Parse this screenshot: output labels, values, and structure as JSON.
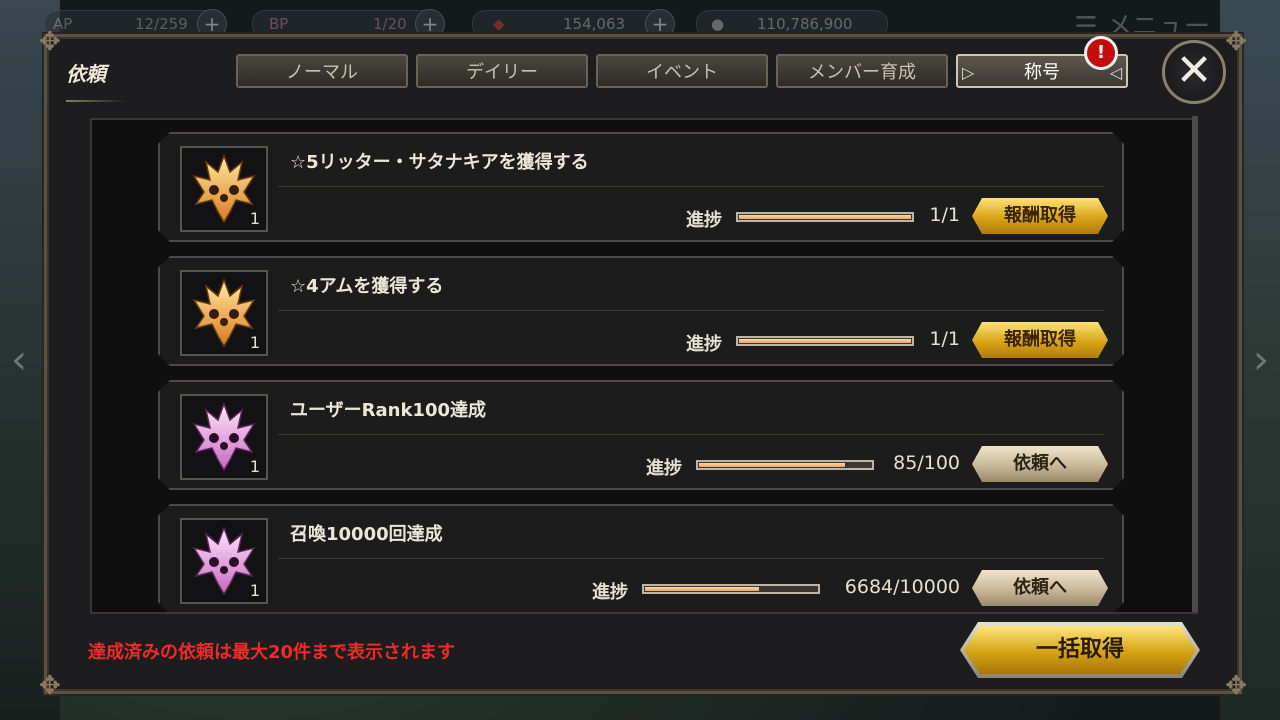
{
  "topbar": {
    "resources": [
      {
        "label": "AP",
        "value": "12/259",
        "icon": "ap-icon"
      },
      {
        "label": "BP",
        "value": "1/20",
        "icon": "bp-icon"
      },
      {
        "label": "",
        "value": "154,063",
        "icon": "gem-icon"
      },
      {
        "label": "",
        "value": "110,786,900",
        "icon": "coin-icon"
      }
    ],
    "menu_label": "メニュー"
  },
  "panel": {
    "title": "依頼",
    "close_icon": "close-icon",
    "alert_icon": "!"
  },
  "tabs": [
    {
      "label": "ノーマル",
      "active": false
    },
    {
      "label": "デイリー",
      "active": false
    },
    {
      "label": "イベント",
      "active": false
    },
    {
      "label": "メンバー育成",
      "active": false
    },
    {
      "label": "称号",
      "active": true
    }
  ],
  "quests": [
    {
      "title": "☆5リッター・サタナキアを獲得する",
      "reward_icon": "gold-emblem-icon",
      "reward_count": "1",
      "progress_label": "進捗",
      "progress": 1.0,
      "count": "1/1",
      "button": "報酬取得",
      "button_style": "gold"
    },
    {
      "title": "☆4アムを獲得する",
      "reward_icon": "gold-emblem-icon",
      "reward_count": "1",
      "progress_label": "進捗",
      "progress": 1.0,
      "count": "1/1",
      "button": "報酬取得",
      "button_style": "gold"
    },
    {
      "title": "ユーザーRank100達成",
      "reward_icon": "pink-emblem-icon",
      "reward_count": "1",
      "progress_label": "進捗",
      "progress": 0.85,
      "count": "85/100",
      "button": "依頼へ",
      "button_style": "silver"
    },
    {
      "title": "召喚10000回達成",
      "reward_icon": "pink-emblem-icon",
      "reward_count": "1",
      "progress_label": "進捗",
      "progress": 0.6684,
      "count": "6684/10000",
      "button": "依頼へ",
      "button_style": "silver"
    }
  ],
  "footer": {
    "note": "達成済みの依頼は最大20件まで表示されます",
    "claim_all": "一括取得"
  },
  "colors": {
    "gold_emblem": "#f0a848",
    "pink_emblem": "#e890d8",
    "note": "#f02a2a"
  }
}
